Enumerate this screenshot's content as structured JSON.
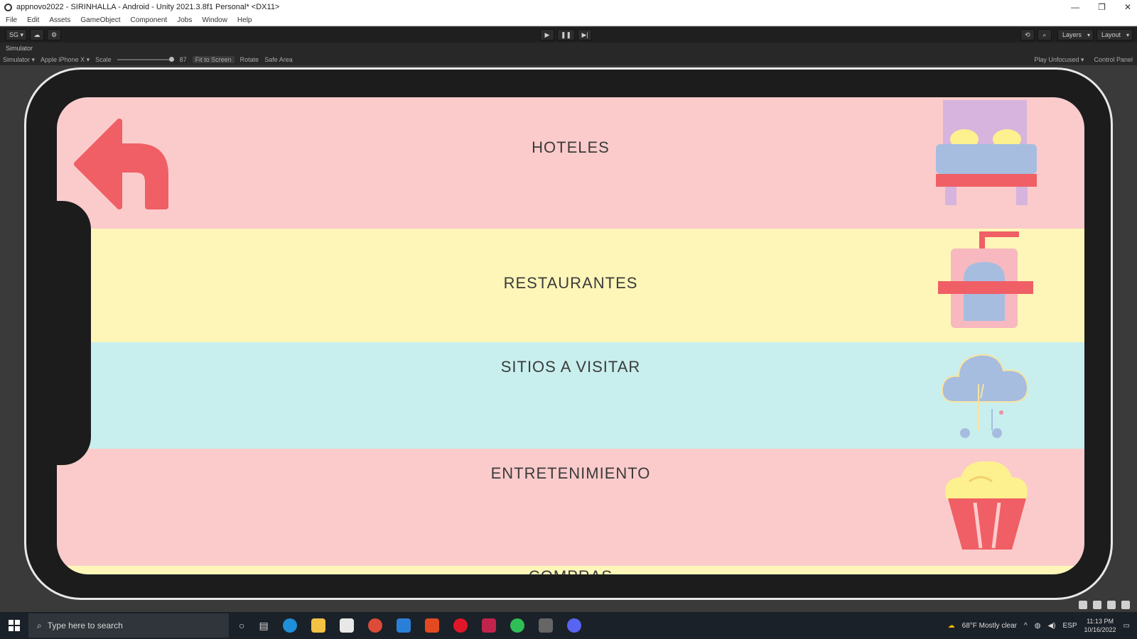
{
  "window": {
    "title": "appnovo2022 - SIRINHALLA - Android - Unity 2021.3.8f1 Personal* <DX11>",
    "controls": [
      "—",
      "❐",
      "✕"
    ]
  },
  "menu": [
    "File",
    "Edit",
    "Assets",
    "GameObject",
    "Component",
    "Jobs",
    "Window",
    "Help"
  ],
  "toolbar": {
    "account": "SG ▾",
    "play": "▶",
    "pause": "❚❚",
    "step": "▶|",
    "layers": "Layers",
    "layout": "Layout"
  },
  "simulator": {
    "tab_label": "Simulator",
    "mode": "Simulator ▾",
    "device": "Apple iPhone X ▾",
    "scale_label": "Scale",
    "scale_value": "87",
    "fit_button": "Fit to Screen",
    "rotate_label": "Rotate",
    "safe_area": "Safe Area",
    "play_mode": "Play Unfocused ▾",
    "control_panel": "Control Panel"
  },
  "app": {
    "categories": [
      {
        "label": "HOTELES",
        "color": "#fbcbcb",
        "icon": "bed-icon"
      },
      {
        "label": "RESTAURANTES",
        "color": "#fdf6b8",
        "icon": "restaurant-icon"
      },
      {
        "label": "SITIOS A VISITAR",
        "color": "#c8efee",
        "icon": "cloud-music-icon"
      },
      {
        "label": "ENTRETENIMIENTO",
        "color": "#fbcbcb",
        "icon": "popcorn-icon"
      },
      {
        "label": "COMPRAS",
        "color": "#fdf6b8",
        "icon": "bag-icon"
      }
    ],
    "back_icon": "back-arrow-icon",
    "colors": {
      "accent_red": "#ef5f65",
      "blue": "#a6bde0",
      "purple": "#d6b4dd",
      "yellow": "#fdf08e"
    }
  },
  "taskbar": {
    "search_placeholder": "Type here to search",
    "weather": "68°F  Mostly clear",
    "language": "ESP",
    "time": "11:13 PM",
    "date": "10/16/2022"
  }
}
